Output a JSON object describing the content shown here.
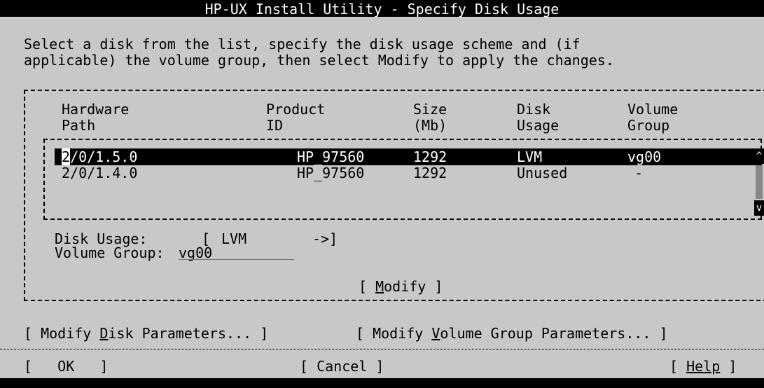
{
  "window": {
    "title": "HP-UX Install Utility - Specify Disk Usage"
  },
  "instructions": {
    "line1": "Select a disk from the list, specify the disk usage scheme and (if",
    "line2": "applicable) the volume group, then select Modify to apply the changes."
  },
  "table": {
    "headers": [
      {
        "line1": "Hardware",
        "line2": "Path"
      },
      {
        "line1": "Product",
        "line2": "ID"
      },
      {
        "line1": "Size",
        "line2": "(Mb)"
      },
      {
        "line1": "Disk",
        "line2": "Usage"
      },
      {
        "line1": "Volume",
        "line2": "Group"
      }
    ],
    "rows": [
      {
        "path_first": "2",
        "path_rest": "/0/1.5.0",
        "product": "HP_97560",
        "size": "1292",
        "usage": "LVM",
        "group": "vg00"
      },
      {
        "path_first": "2",
        "path_rest": "/0/1.4.0",
        "product": "HP_97560",
        "size": "1292",
        "usage": "Unused",
        "group": "-"
      }
    ],
    "selected_row": 0
  },
  "scrollbar": {
    "up_glyph": "^",
    "down_glyph": "v"
  },
  "form": {
    "disk_usage_label": "Disk Usage:",
    "disk_usage_open": "[",
    "disk_usage_value": "LVM",
    "disk_usage_arrow": "->]",
    "volume_group_label": "Volume Group:",
    "volume_group_value": "vg00"
  },
  "buttons": {
    "modify": {
      "open": "[ ",
      "mnemonic": "M",
      "rest": "odify ]"
    },
    "modify_disk": {
      "pre": "[ Modify ",
      "mnemonic": "D",
      "post": "isk Parameters... ]"
    },
    "modify_vg": {
      "pre": "[ Modify ",
      "mnemonic": "V",
      "post": "olume Group Parameters... ]"
    },
    "ok": {
      "label": "[   OK   ]"
    },
    "cancel": {
      "label": "[ Cancel ]"
    },
    "help": {
      "open": "[ ",
      "label": "Help",
      "close": " ]"
    }
  },
  "colors": {
    "background": "#c8c8c8",
    "foreground": "#000000",
    "highlight_fg": "#ffffff"
  }
}
